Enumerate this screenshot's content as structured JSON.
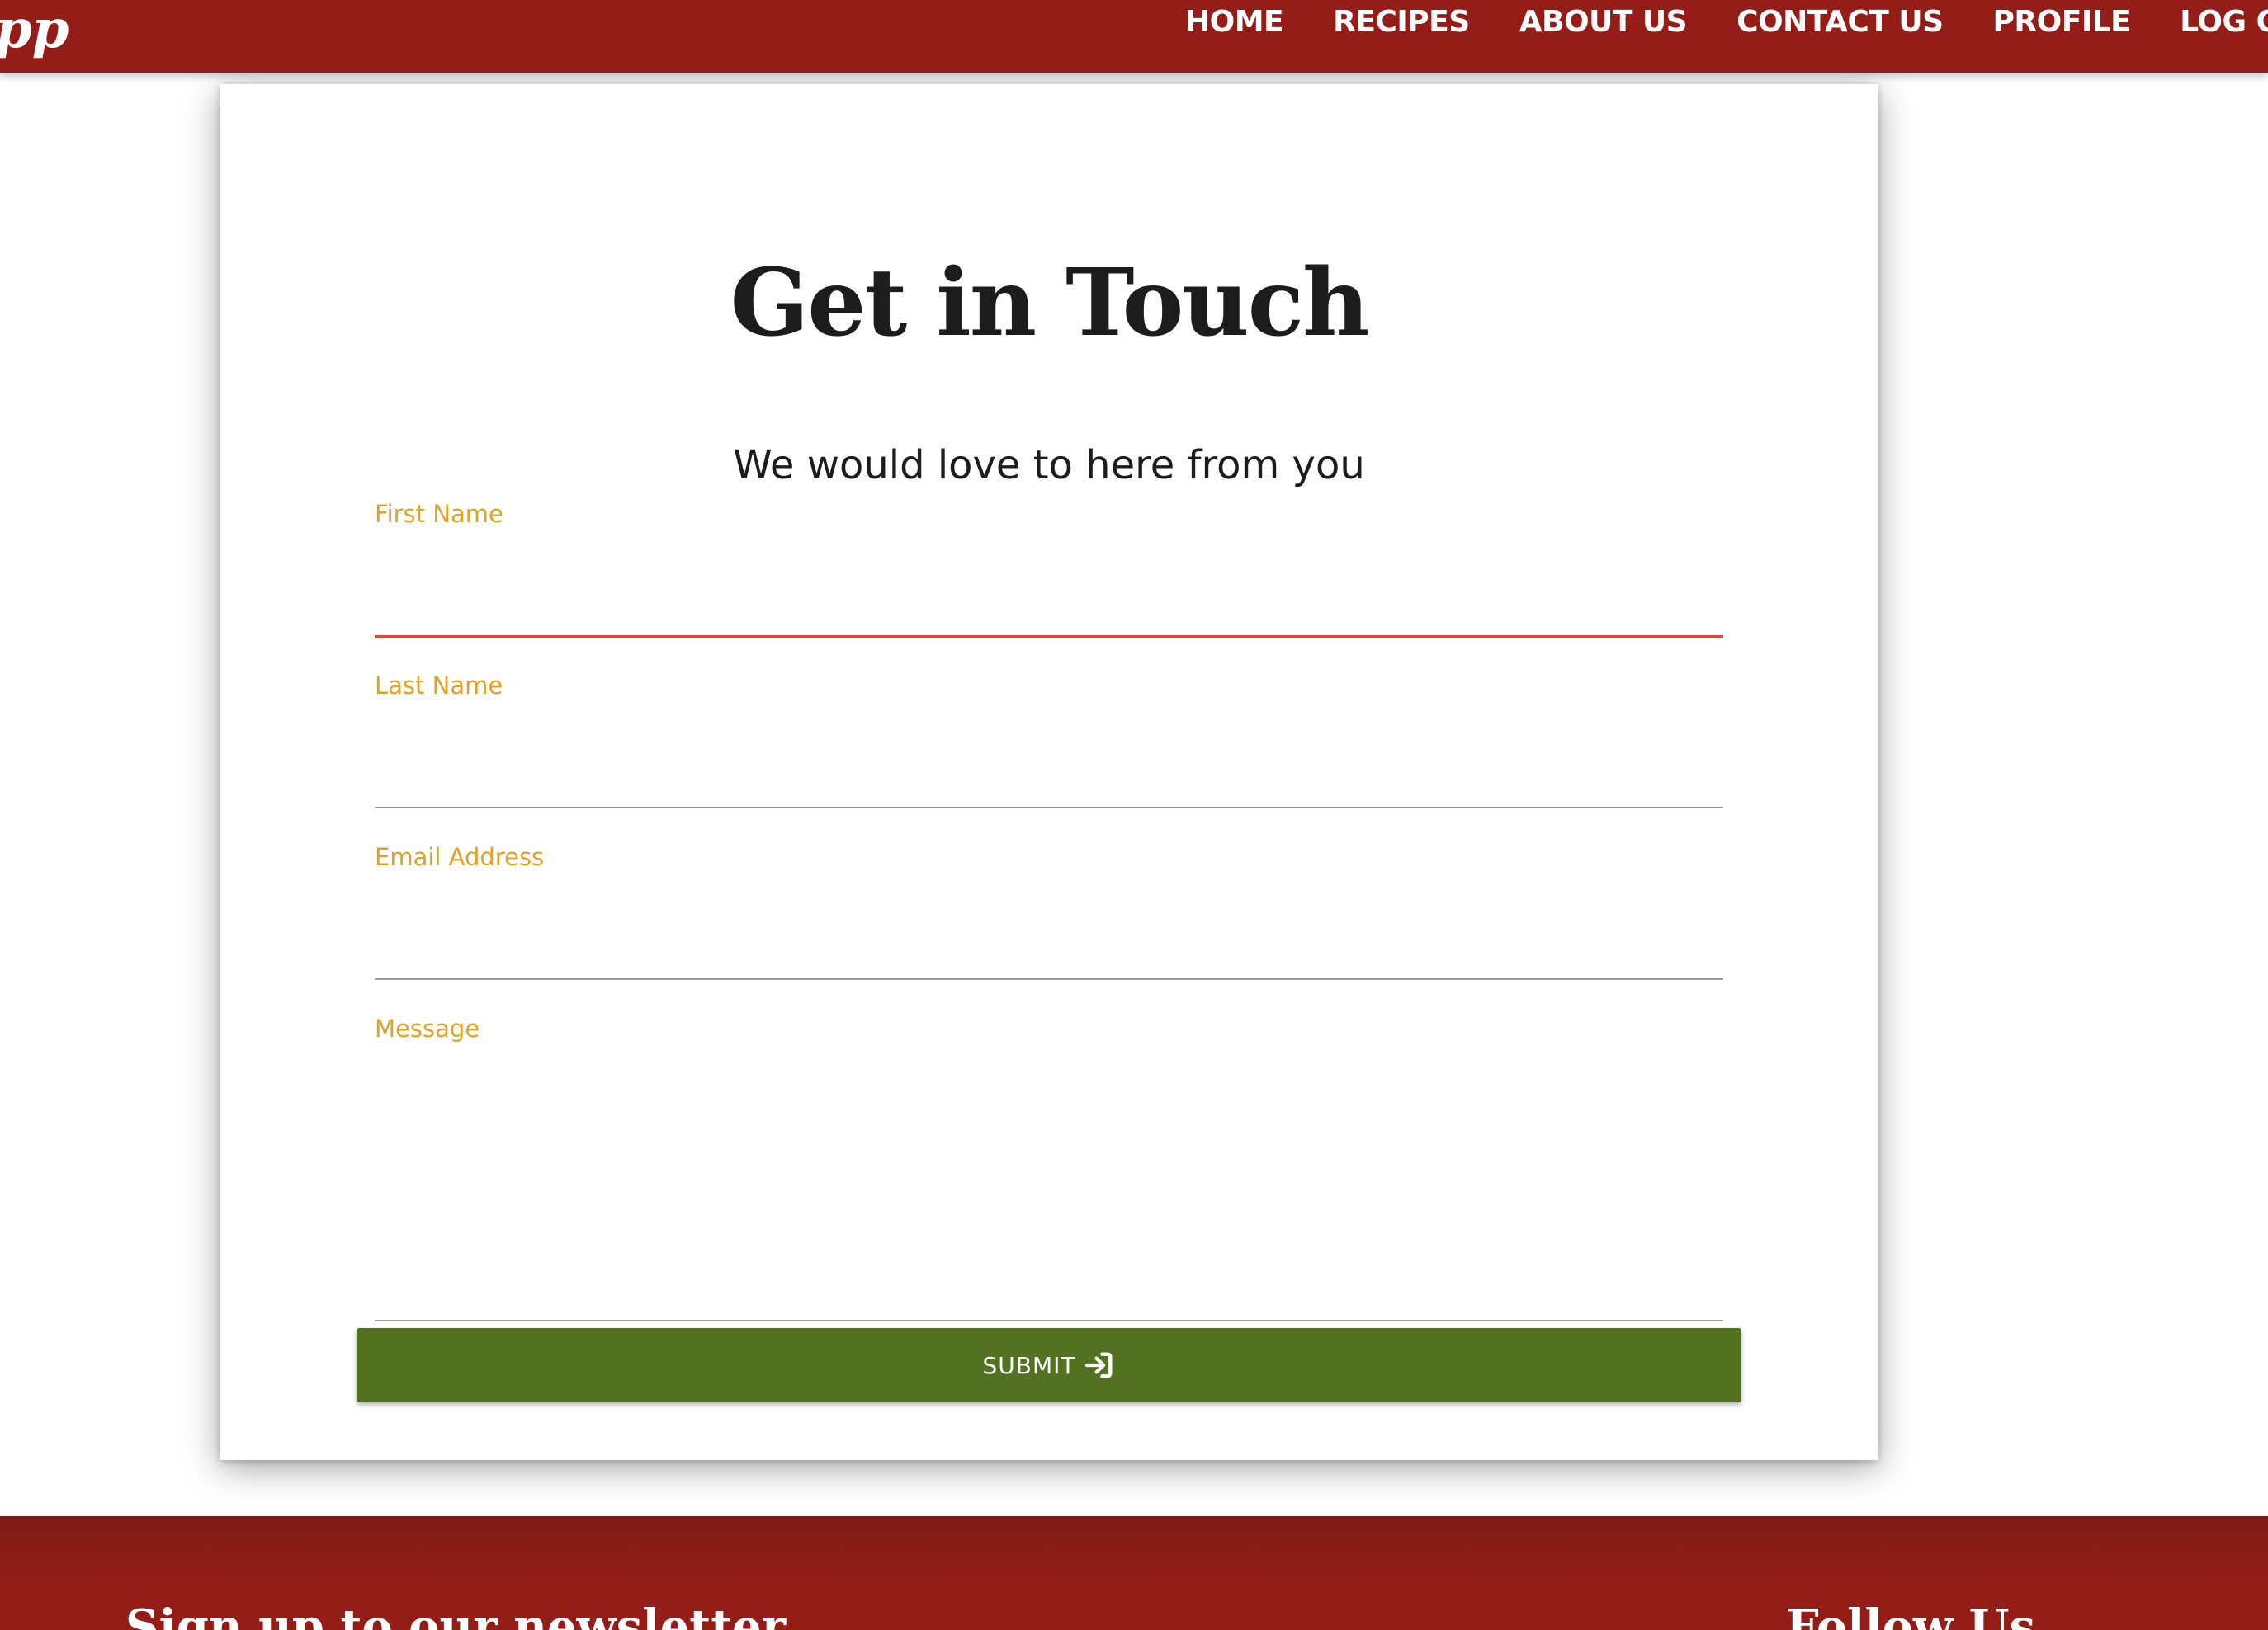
{
  "navbar": {
    "brand_text": "pp",
    "links": [
      "HOME",
      "RECIPES",
      "ABOUT US",
      "CONTACT US",
      "PROFILE",
      "LOG OUT"
    ]
  },
  "contact": {
    "title": "Get in Touch",
    "subtitle": "We would love to here from you",
    "fields": {
      "first_name_label": "First Name",
      "last_name_label": "Last Name",
      "email_label": "Email Address",
      "message_label": "Message"
    },
    "submit_label": "SUBMIT",
    "submit_icon": "login-arrow-icon"
  },
  "footer": {
    "newsletter_heading": "Sign up to our newsletter",
    "follow_heading": "Follow Us"
  },
  "colors": {
    "primary_red": "#951d18",
    "label_gold": "#e0a328",
    "active_underline": "#d94a33",
    "submit_green": "#527121"
  }
}
